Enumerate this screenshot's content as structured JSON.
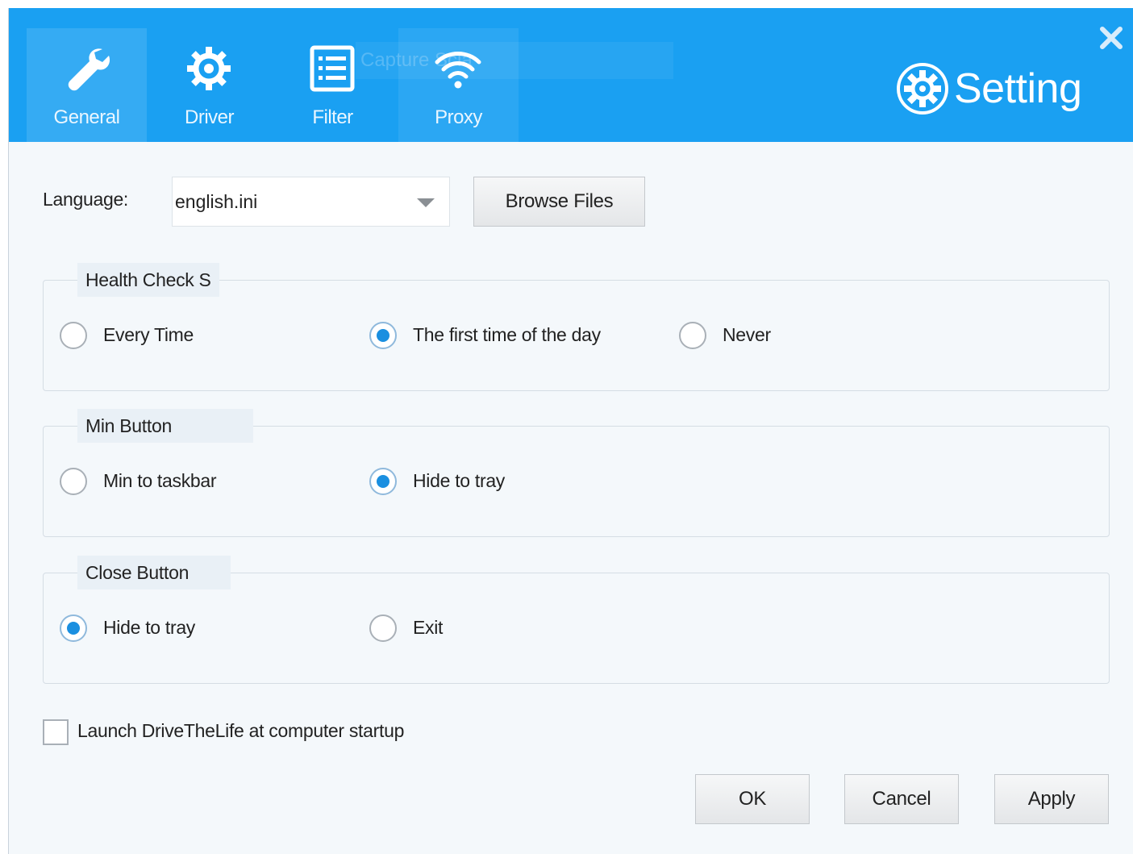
{
  "tabs": [
    {
      "label": "General",
      "icon": "wrench-icon"
    },
    {
      "label": "Driver",
      "icon": "gear-icon"
    },
    {
      "label": "Filter",
      "icon": "list-icon"
    },
    {
      "label": "Proxy",
      "icon": "wifi-icon"
    }
  ],
  "header": {
    "ghost_text": "Capture  Scla",
    "title": "Setting",
    "close": "✕"
  },
  "language": {
    "label": "Language:",
    "value": "english.ini",
    "browse_label": "Browse Files"
  },
  "health_check": {
    "legend": "Health Check S",
    "options": [
      "Every Time",
      "The first time of the day",
      "Never"
    ],
    "selected": "The first time of the day"
  },
  "min_button": {
    "legend": "Min Button",
    "options": [
      "Min to taskbar",
      "Hide to tray"
    ],
    "selected": "Hide to tray"
  },
  "close_button": {
    "legend": "Close Button",
    "options": [
      "Hide to tray",
      "Exit"
    ],
    "selected": "Hide to tray"
  },
  "startup": {
    "label": "Launch DriveTheLife at computer startup",
    "checked": false
  },
  "footer": {
    "ok": "OK",
    "cancel": "Cancel",
    "apply": "Apply"
  },
  "colors": {
    "header_bg": "#1aa0f2",
    "window_bg": "#f4f8fb",
    "radio_accent": "#1a8fe0"
  }
}
